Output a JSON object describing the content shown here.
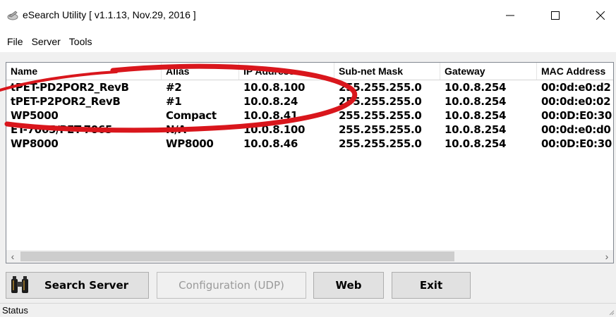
{
  "window": {
    "title": "eSearch Utility [ v1.1.13, Nov.29, 2016 ]",
    "controls": {
      "minimize": "—",
      "maximize": "☐",
      "close": "✕"
    }
  },
  "menu": {
    "items": [
      "File",
      "Server",
      "Tools"
    ]
  },
  "table": {
    "columns": [
      "Name",
      "Alias",
      "IP Address",
      "Sub-net Mask",
      "Gateway",
      "MAC Address"
    ],
    "rows": [
      [
        "tPET-PD2POR2_RevB",
        "#2",
        "10.0.8.100",
        "255.255.255.0",
        "10.0.8.254",
        "00:0d:e0:d2"
      ],
      [
        "tPET-P2POR2_RevB",
        "#1",
        "10.0.8.24",
        "255.255.255.0",
        "10.0.8.254",
        "00:0d:e0:02"
      ],
      [
        "WP5000",
        "Compact",
        "10.0.8.41",
        "255.255.255.0",
        "10.0.8.254",
        "00:0D:E0:30"
      ],
      [
        "ET-7065/PET-7065",
        "N/A",
        "10.0.8.100",
        "255.255.255.0",
        "10.0.8.254",
        "00:0d:e0:d0"
      ],
      [
        "WP8000",
        "WP8000",
        "10.0.8.46",
        "255.255.255.0",
        "10.0.8.254",
        "00:0D:E0:30"
      ]
    ]
  },
  "scrollbar": {
    "left_arrow": "‹",
    "right_arrow": "›"
  },
  "buttons": {
    "search": "Search Server",
    "config": "Configuration (UDP)",
    "web": "Web",
    "exit": "Exit"
  },
  "status": {
    "text": "Status"
  },
  "colors": {
    "annotation": "#d9161c",
    "disabled_text": "#9a9a9a"
  },
  "icons": {
    "app": "search-utility-icon",
    "search": "binoculars-icon"
  }
}
